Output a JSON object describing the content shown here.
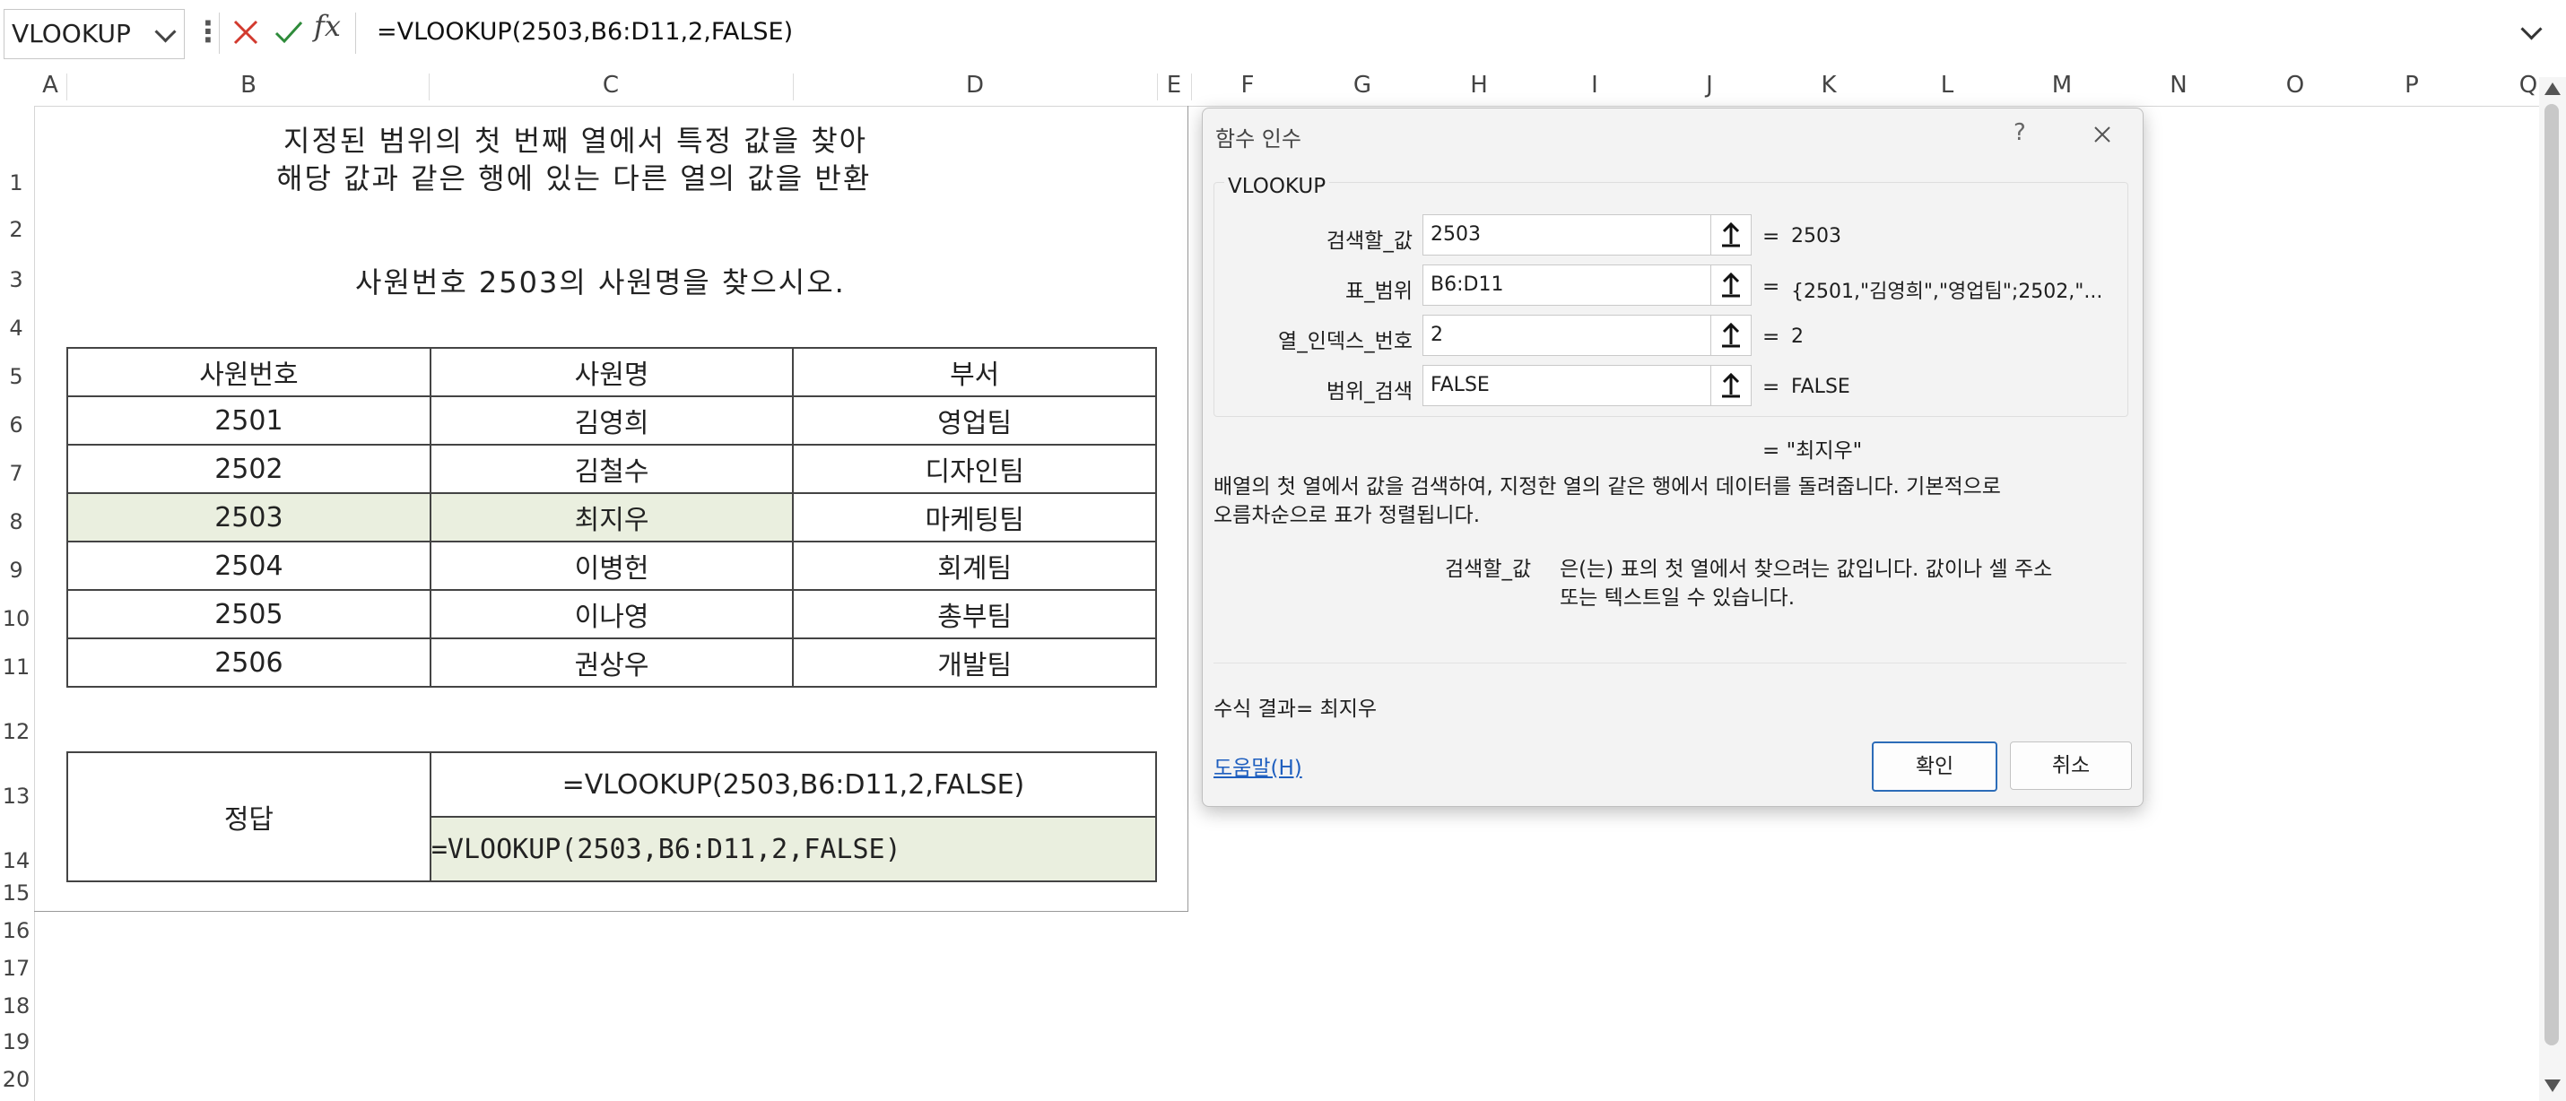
{
  "formula_bar": {
    "name_box": "VLOOKUP",
    "cancel_icon": "x-icon",
    "enter_icon": "check-icon",
    "fx_label": "fx",
    "formula": "=VLOOKUP(2503,B6:D11,2,FALSE)"
  },
  "columns": [
    "A",
    "B",
    "C",
    "D",
    "E",
    "F",
    "G",
    "H",
    "I",
    "J",
    "K",
    "L",
    "M",
    "N",
    "O",
    "P",
    "Q"
  ],
  "rows": [
    "1",
    "2",
    "3",
    "4",
    "5",
    "6",
    "7",
    "8",
    "9",
    "10",
    "11",
    "12",
    "13",
    "14",
    "15",
    "16",
    "17",
    "18",
    "19",
    "20"
  ],
  "sheet": {
    "title_line1": "지정된 범위의 첫 번째 열에서 특정 값을 찾아",
    "title_line2": "해당 값과 같은 행에 있는 다른 열의 값을 반환",
    "question": "사원번호 2503의 사원명을 찾으시오.",
    "table": {
      "headers": [
        "사원번호",
        "사원명",
        "부서"
      ],
      "rows": [
        [
          "2501",
          "김영희",
          "영업팀"
        ],
        [
          "2502",
          "김철수",
          "디자인팀"
        ],
        [
          "2503",
          "최지우",
          "마케팅팀"
        ],
        [
          "2504",
          "이병헌",
          "회계팀"
        ],
        [
          "2505",
          "이나영",
          "총부팀"
        ],
        [
          "2506",
          "권상우",
          "개발팀"
        ]
      ]
    },
    "answer": {
      "label": "정답",
      "formula_display": "=VLOOKUP(2503,B6:D11,2,FALSE)",
      "formula_input": "=VLOOKUP(2503,B6:D11,2,FALSE)"
    }
  },
  "dialog": {
    "title": "함수 인수",
    "help_glyph": "?",
    "function_name": "VLOOKUP",
    "args": [
      {
        "label": "검색할_값",
        "value": "2503",
        "result": "2503"
      },
      {
        "label": "표_범위",
        "value": "B6:D11",
        "result": "{2501,\"김영희\",\"영업팀\";2502,\"..."
      },
      {
        "label": "열_인덱스_번호",
        "value": "2",
        "result": "2"
      },
      {
        "label": "범위_검색",
        "value": "FALSE",
        "result": "FALSE"
      }
    ],
    "eq": "=",
    "overall_result": "= \"최지우\"",
    "description_line1": "배열의 첫 열에서 값을 검색하여, 지정한 열의 같은 행에서 데이터를 돌려줍니다. 기본적으로",
    "description_line2": "오름차순으로 표가 정렬됩니다.",
    "arg_help_label": "검색할_값",
    "arg_help_line1": "은(는) 표의 첫 열에서 찾으려는 값입니다. 값이나 셀 주소",
    "arg_help_line2": "또는 텍스트일 수 있습니다.",
    "formula_result": "수식 결과=  최지우",
    "help_link": "도움말(H)",
    "ok": "확인",
    "cancel": "취소"
  }
}
